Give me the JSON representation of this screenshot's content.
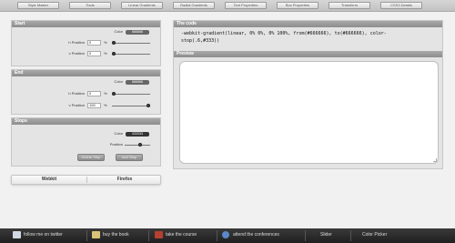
{
  "nav": {
    "tabs": [
      "Style Master",
      "Tools",
      "Linear Gradients",
      "Radial Gradients",
      "Text Properties",
      "Box Properties",
      "Transform",
      "CSS3 Details"
    ]
  },
  "start": {
    "title": "Start",
    "color_label": "Color",
    "color_value": "666666",
    "hpos_label": "h Position",
    "hpos_value": "0",
    "vpos_label": "v Position",
    "vpos_value": "0",
    "pct": "%"
  },
  "end": {
    "title": "End",
    "color_label": "Color",
    "color_value": "666666",
    "hpos_label": "h Position",
    "hpos_value": "0",
    "vpos_label": "v Position",
    "vpos_value": "100",
    "pct": "%"
  },
  "stops": {
    "title": "Stops",
    "color_label": "Color",
    "color_value": "333333",
    "position_label": "Position",
    "delete_label": "Delete Stop",
    "add_label": "Add Stop"
  },
  "browsers": {
    "webkit": "Webkit",
    "firefox": "Firefox"
  },
  "code": {
    "title": "The code",
    "line1": "-webkit-gradient(linear, 0% 0%, 0% 100%, from(#666666), to(#666666), color-",
    "line2": "stop(.6,#333))"
  },
  "preview": {
    "title": "Preview"
  },
  "footer": {
    "twitter": "follow me on twitter",
    "book": "buy the book",
    "course": "take the course",
    "conferences": "attend the conferences",
    "slider": "Slider",
    "color_picker": "Color Picker"
  },
  "colors": {
    "swatch_dark": "#666666",
    "stop_swatch": "#333333",
    "footer_bg": "#2b2b2b"
  }
}
